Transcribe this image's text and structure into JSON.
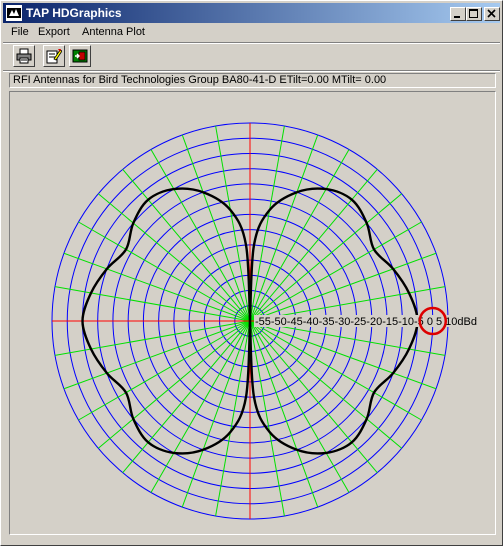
{
  "window": {
    "title": "TAP HDGraphics",
    "minimize_glyph": "_",
    "maximize_glyph": "□",
    "close_glyph": "×"
  },
  "menu": [
    "File",
    "Export",
    "Antenna Plot"
  ],
  "toolbar": {
    "buttons": [
      {
        "name": "print-button",
        "icon": "printer-icon"
      },
      {
        "name": "edit-button",
        "icon": "edit-pencil-icon"
      },
      {
        "name": "exit-button",
        "icon": "exit-door-icon"
      }
    ]
  },
  "info_line": "RFI Antennas for Bird Technologies Group BA80-41-D ETilt=0.00 MTilt= 0.00",
  "colors": {
    "ring": "#0000ff",
    "radial": "#00e000",
    "axis": "#ff0000",
    "pattern": "#000000",
    "marker": "#dd0000",
    "plot_bg": "#d4d0c8"
  },
  "chart_data": {
    "type": "polar",
    "ring_labels": [
      "-55",
      "-50",
      "-45",
      "-40",
      "-35",
      "-30",
      "-25",
      "-20",
      "-15",
      "-10",
      "-5",
      "0",
      "5",
      "10dBd"
    ],
    "ring_label_text": "-55-50-45-40-35-30-25-20-15-10-5  0  5 10dBd",
    "radial_step_deg": 10,
    "range_dbd": [
      -55,
      10
    ],
    "series": [
      {
        "pattern_points_deg_db": [
          [
            0,
            -55
          ],
          [
            3,
            -30
          ],
          [
            10,
            -18
          ],
          [
            20,
            -10
          ],
          [
            30,
            -5
          ],
          [
            40,
            -3
          ],
          [
            50,
            -5
          ],
          [
            60,
            -8
          ],
          [
            70,
            -5
          ],
          [
            80,
            -2
          ],
          [
            90,
            0
          ],
          [
            100,
            -2
          ],
          [
            110,
            -5
          ],
          [
            120,
            -8
          ],
          [
            130,
            -5
          ],
          [
            140,
            -3
          ],
          [
            150,
            -5
          ],
          [
            160,
            -10
          ],
          [
            170,
            -18
          ],
          [
            177,
            -30
          ],
          [
            180,
            -55
          ]
        ]
      }
    ],
    "marker": {
      "db": 5,
      "angle_deg": 90
    }
  }
}
